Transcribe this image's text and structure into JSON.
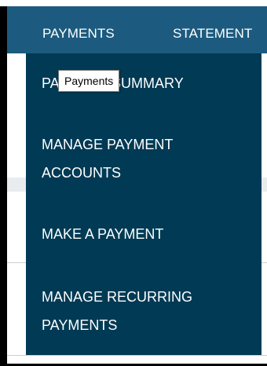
{
  "nav": {
    "payments_label": "PAYMENTS",
    "statements_label": "STATEMENT"
  },
  "dropdown": {
    "items": [
      {
        "label": "PAYMENT SUMMARY"
      },
      {
        "label": "MANAGE PAYMENT ACCOUNTS"
      },
      {
        "label": "MAKE A PAYMENT"
      },
      {
        "label": "MANAGE RECURRING PAYMENTS"
      }
    ]
  },
  "tooltip": {
    "text": "Payments"
  },
  "colors": {
    "navbar": "#1c5b7f",
    "dropdown": "#003a54",
    "text": "#ffffff"
  }
}
